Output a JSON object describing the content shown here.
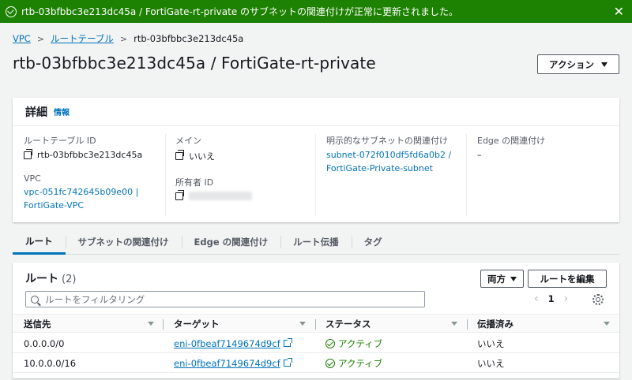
{
  "flash": {
    "message": "rtb-03bfbbc3e213dc45a / FortiGate-rt-private のサブネットの関連付けが正常に更新されました。",
    "close": "✕"
  },
  "breadcrumb": {
    "items": [
      "VPC",
      "ルートテーブル",
      "rtb-03bfbbc3e213dc45a"
    ],
    "separator": ">"
  },
  "page_title": "rtb-03bfbbc3e213dc45a / FortiGate-rt-private",
  "actions_button": "アクション",
  "details": {
    "heading": "詳細",
    "info": "情報",
    "route_table_id_label": "ルートテーブル ID",
    "route_table_id": "rtb-03bfbbc3e213dc45a",
    "vpc_label": "VPC",
    "vpc_line1": "vpc-051fc742645b09e00 |",
    "vpc_line2": "FortiGate-VPC",
    "main_label": "メイン",
    "main_value": "いいえ",
    "owner_label": "所有者 ID",
    "explicit_label": "明示的なサブネットの関連付け",
    "explicit_line1": "subnet-072f010df5fd6a0b2 /",
    "explicit_line2": "FortiGate-Private-subnet",
    "edge_label": "Edge の関連付け",
    "edge_value": "–"
  },
  "tabs": [
    "ルート",
    "サブネットの関連付け",
    "Edge の関連付け",
    "ルート伝播",
    "タグ"
  ],
  "routes": {
    "heading": "ルート",
    "count": "(2)",
    "filter_button": "両方",
    "edit_button": "ルートを編集",
    "search_placeholder": "ルートをフィルタリング",
    "page": "1",
    "prev": "‹",
    "next": "›",
    "columns": [
      "送信先",
      "ターゲット",
      "ステータス",
      "伝播済み"
    ],
    "rows": [
      {
        "destination": "0.0.0.0/0",
        "target": "eni-0fbeaf7149674d9cf",
        "status": "アクティブ",
        "propagated": "いいえ"
      },
      {
        "destination": "10.0.0.0/16",
        "target": "eni-0fbeaf7149674d9cf",
        "status": "アクティブ",
        "propagated": "いいえ"
      }
    ]
  },
  "colors": {
    "success": "#1d8102",
    "link": "#0073bb",
    "background": "#f2f3f3"
  }
}
